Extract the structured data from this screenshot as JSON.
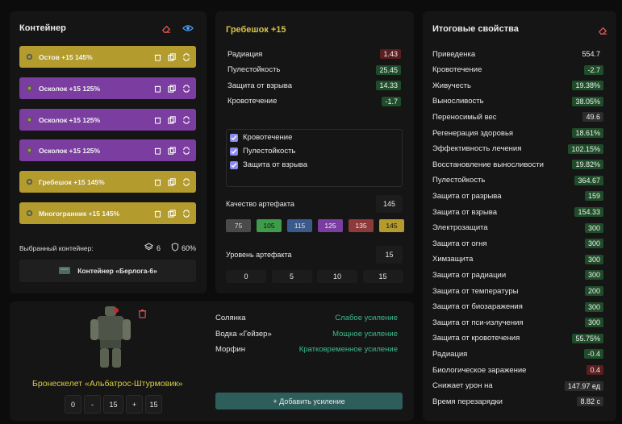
{
  "container": {
    "title": "Контейнер",
    "slots": [
      {
        "name": "Остов +15 145%",
        "color": "yellow"
      },
      {
        "name": "Осколок +15 125%",
        "color": "purple"
      },
      {
        "name": "Осколок +15 125%",
        "color": "purple"
      },
      {
        "name": "Осколок +15 125%",
        "color": "purple"
      },
      {
        "name": "Гребешок +15 145%",
        "color": "yellow"
      },
      {
        "name": "Многогранник +15 145%",
        "color": "yellow"
      }
    ],
    "selected_label": "Выбранный контейнер:",
    "capacity": "6",
    "protection": "60%",
    "container_name": "Контейнер «Берлога-6»"
  },
  "artifact": {
    "title": "Гребешок +15",
    "stats": [
      {
        "label": "Радиация",
        "value": "1.43",
        "tone": "red"
      },
      {
        "label": "Пулестойкость",
        "value": "25.45",
        "tone": "green"
      },
      {
        "label": "Защита от взрыва",
        "value": "14.33",
        "tone": "green"
      },
      {
        "label": "Кровотечение",
        "value": "-1.7",
        "tone": "green"
      }
    ],
    "checkboxes": [
      "Кровотечение",
      "Пулестойкость",
      "Защита от взрыва"
    ],
    "quality_label": "Качество артефакта",
    "quality_value": "145",
    "quality_options": [
      {
        "label": "75",
        "color": "#4a4a4a",
        "text": "#dcdcdc"
      },
      {
        "label": "105",
        "color": "#3f9c4a",
        "text": "#111"
      },
      {
        "label": "115",
        "color": "#3b5a8c",
        "text": "#e0e0e0"
      },
      {
        "label": "125",
        "color": "#7b3ea0",
        "text": "#f0f0f0"
      },
      {
        "label": "135",
        "color": "#8c3a3a",
        "text": "#f0f0f0"
      },
      {
        "label": "145",
        "color": "#b39b2e",
        "text": "#111"
      }
    ],
    "level_label": "Уровень артефакта",
    "level_value": "15",
    "level_options": [
      "0",
      "5",
      "10",
      "15"
    ]
  },
  "armor": {
    "name": "Бронескелет «Альбатрос-Штурмовик»",
    "level": {
      "min": "0",
      "minus": "-",
      "value": "15",
      "plus": "+",
      "max": "15"
    },
    "boosts": [
      {
        "item": "Солянка",
        "effect": "Слабое усиление"
      },
      {
        "item": "Водка «Гейзер»",
        "effect": "Мощное усиление"
      },
      {
        "item": "Морфин",
        "effect": "Кратковременное усиление"
      }
    ],
    "add_button": "+ Добавить усиление"
  },
  "totals": {
    "title": "Итоговые свойства",
    "rows": [
      {
        "label": "Приведенка",
        "value": "554.7",
        "tone": "none"
      },
      {
        "label": "Кровотечение",
        "value": "-2.7",
        "tone": "green"
      },
      {
        "label": "Живучесть",
        "value": "19.38%",
        "tone": "green"
      },
      {
        "label": "Выносливость",
        "value": "38.05%",
        "tone": "green"
      },
      {
        "label": "Переносимый вес",
        "value": "49.6",
        "tone": "grey"
      },
      {
        "label": "Регенерация здоровья",
        "value": "18.61%",
        "tone": "green"
      },
      {
        "label": "Эффективность лечения",
        "value": "102.15%",
        "tone": "green"
      },
      {
        "label": "Восстановление выносливости",
        "value": "19.82%",
        "tone": "green"
      },
      {
        "label": "Пулестойкость",
        "value": "364.67",
        "tone": "green"
      },
      {
        "label": "Защита от разрыва",
        "value": "159",
        "tone": "green"
      },
      {
        "label": "Защита от взрыва",
        "value": "154.33",
        "tone": "green"
      },
      {
        "label": "Электрозащита",
        "value": "300",
        "tone": "green"
      },
      {
        "label": "Защита от огня",
        "value": "300",
        "tone": "green"
      },
      {
        "label": "Химзащита",
        "value": "300",
        "tone": "green"
      },
      {
        "label": "Защита от радиации",
        "value": "300",
        "tone": "green"
      },
      {
        "label": "Защита от температуры",
        "value": "200",
        "tone": "green"
      },
      {
        "label": "Защита от биозаражения",
        "value": "300",
        "tone": "green"
      },
      {
        "label": "Защита от пси-излучения",
        "value": "300",
        "tone": "green"
      },
      {
        "label": "Защита от кровотечения",
        "value": "55.75%",
        "tone": "green"
      },
      {
        "label": "Радиация",
        "value": "-0.4",
        "tone": "green"
      },
      {
        "label": "Биологическое заражение",
        "value": "0.4",
        "tone": "red"
      },
      {
        "label": "Снижает урон на",
        "value": "147.97 ед",
        "tone": "grey"
      },
      {
        "label": "Время перезарядки",
        "value": "8.82 с",
        "tone": "grey"
      }
    ]
  }
}
